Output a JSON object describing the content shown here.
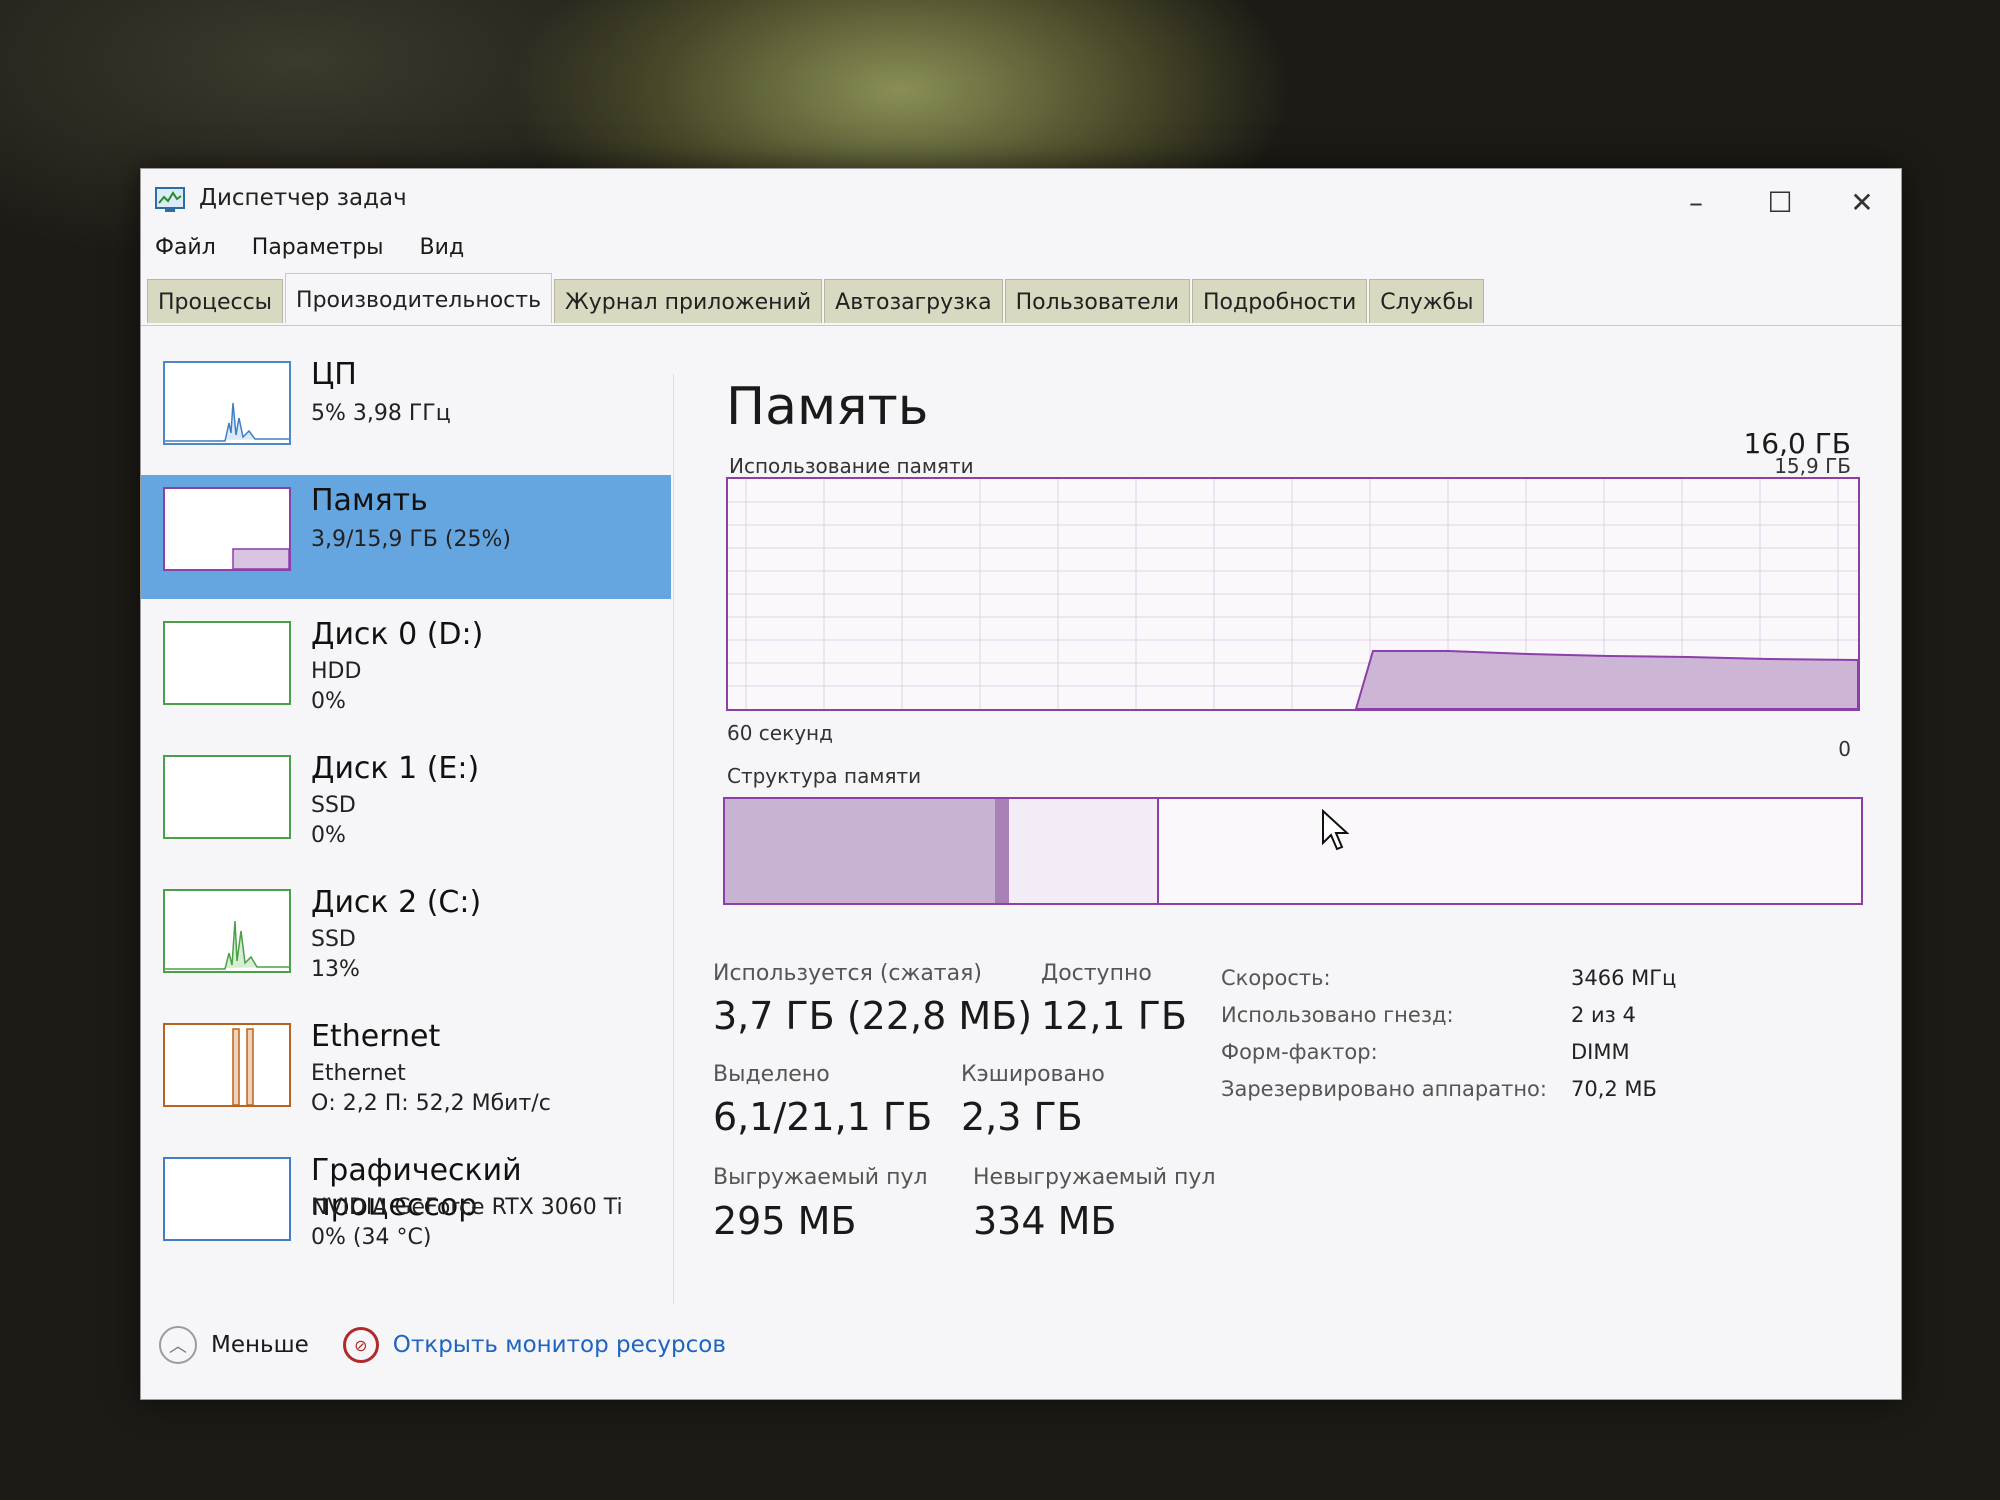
{
  "window": {
    "title": "Диспетчер задач",
    "minimize": "–",
    "maximize": "☐",
    "close": "✕"
  },
  "menu": [
    "Файл",
    "Параметры",
    "Вид"
  ],
  "tabs": [
    "Процессы",
    "Производительность",
    "Журнал приложений",
    "Автозагрузка",
    "Пользователи",
    "Подробности",
    "Службы"
  ],
  "sidebar": {
    "items": [
      {
        "name": "ЦП",
        "line1": "5% 3,98 ГГц",
        "line2": ""
      },
      {
        "name": "Память",
        "line1": "3,9/15,9 ГБ (25%)",
        "line2": ""
      },
      {
        "name": "Диск 0 (D:)",
        "line1": "HDD",
        "line2": "0%"
      },
      {
        "name": "Диск 1 (E:)",
        "line1": "SSD",
        "line2": "0%"
      },
      {
        "name": "Диск 2 (C:)",
        "line1": "SSD",
        "line2": "13%"
      },
      {
        "name": "Ethernet",
        "line1": "Ethernet",
        "line2": "О: 2,2 П: 52,2 Мбит/с"
      },
      {
        "name": "Графический процессор",
        "line1": "NVIDIA GeForce RTX 3060 Ti",
        "line2": "0% (34 °C)"
      }
    ]
  },
  "memory": {
    "title": "Память",
    "total": "16,0 ГБ",
    "usage_label": "Использование памяти",
    "usage_max": "15,9 ГБ",
    "time_label": "60 секунд",
    "zero": "0",
    "structure_label": "Структура памяти",
    "stats": {
      "in_use_label": "Используется (сжатая)",
      "in_use": "3,7 ГБ (22,8 МБ)",
      "available_label": "Доступно",
      "available": "12,1 ГБ",
      "committed_label": "Выделено",
      "committed": "6,1/21,1 ГБ",
      "cached_label": "Кэшировано",
      "cached": "2,3 ГБ",
      "paged_label": "Выгружаемый пул",
      "paged": "295 МБ",
      "nonpaged_label": "Невыгружаемый пул",
      "nonpaged": "334 МБ"
    },
    "details": {
      "speed_k": "Скорость:",
      "speed_v": "3466 МГц",
      "slots_k": "Использовано гнезд:",
      "slots_v": "2 из 4",
      "form_k": "Форм-фактор:",
      "form_v": "DIMM",
      "reserved_k": "Зарезервировано аппаратно:",
      "reserved_v": "70,2 МБ"
    }
  },
  "bottom": {
    "less": "Меньше",
    "monitor": "Открыть монитор ресурсов"
  },
  "colors": {
    "memory_accent": "#8b3fa8",
    "selection": "#66a6e0",
    "link": "#1d64c4"
  }
}
